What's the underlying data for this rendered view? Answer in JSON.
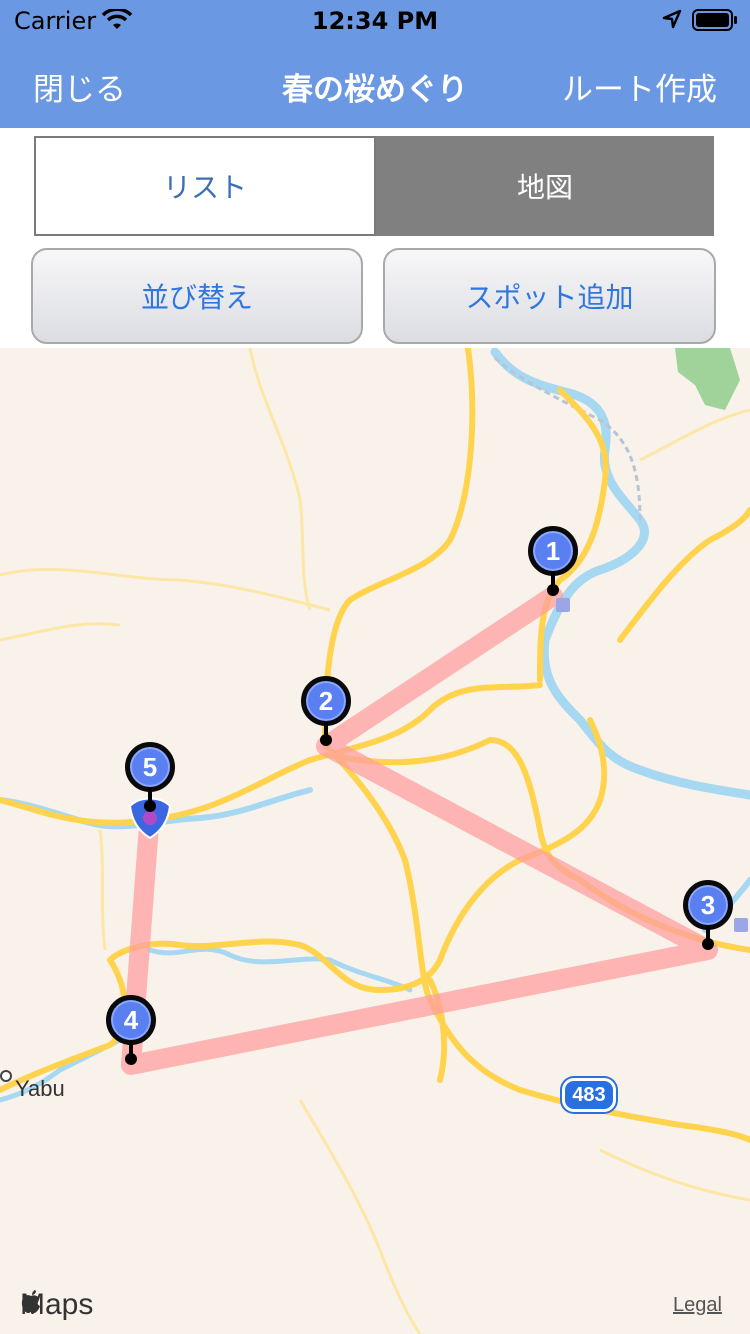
{
  "status_bar": {
    "carrier": "Carrier",
    "time": "12:34 PM",
    "icons": [
      "wifi-icon",
      "location-arrow-icon",
      "battery-icon"
    ]
  },
  "nav": {
    "left": "閉じる",
    "title": "春の桜めぐり",
    "right": "ルート作成"
  },
  "segments": {
    "list": "リスト",
    "map": "地図",
    "selected": "map"
  },
  "buttons": {
    "sort": "並び替え",
    "add_spot": "スポット追加"
  },
  "map": {
    "route_order": [
      "1",
      "2",
      "3",
      "4",
      "5"
    ],
    "place_label": "Yabu",
    "route_shield": "483",
    "provider": "Maps",
    "legal": "Legal",
    "pins": [
      {
        "label": "1"
      },
      {
        "label": "2"
      },
      {
        "label": "3"
      },
      {
        "label": "4"
      },
      {
        "label": "5"
      }
    ],
    "colors": {
      "route": "#ff9f9f",
      "pin": "#5a7ff0",
      "water": "#a6d8f2",
      "road": "#ffd34d",
      "park": "#9fd39a"
    }
  }
}
